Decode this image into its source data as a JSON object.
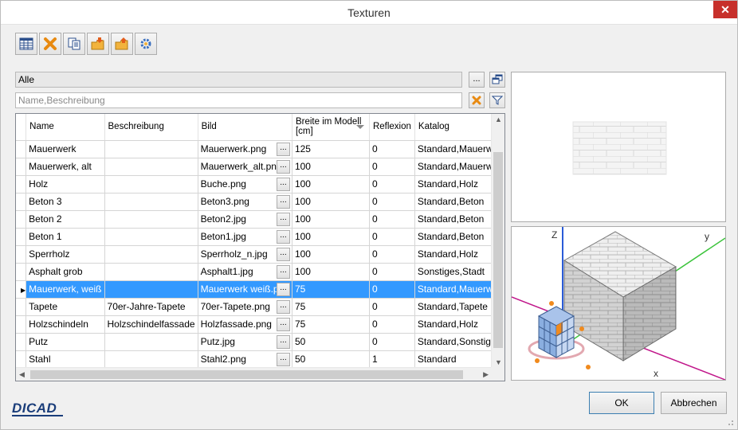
{
  "window": {
    "title": "Texturen"
  },
  "toolbar": {
    "buttons": [
      "table-icon",
      "delete-icon",
      "copy-icon",
      "import-icon",
      "export-icon",
      "settings-icon"
    ]
  },
  "filters": {
    "category_value": "Alle",
    "category_browse_label": "...",
    "search_placeholder": "Name,Beschreibung"
  },
  "table": {
    "columns": [
      "Name",
      "Beschreibung",
      "Bild",
      "Breite im Modell [cm]",
      "Reflexion",
      "Katalog"
    ],
    "ellipsis_label": "...",
    "rows": [
      {
        "name": "Mauerwerk",
        "beschreibung": "",
        "bild": "Mauerwerk.png",
        "breite": "125",
        "reflexion": "0",
        "katalog": "Standard,Mauerwerk",
        "selected": false
      },
      {
        "name": "Mauerwerk, alt",
        "beschreibung": "",
        "bild": "Mauerwerk_alt.png",
        "breite": "100",
        "reflexion": "0",
        "katalog": "Standard,Mauerwerk",
        "selected": false
      },
      {
        "name": "Holz",
        "beschreibung": "",
        "bild": "Buche.png",
        "breite": "100",
        "reflexion": "0",
        "katalog": "Standard,Holz",
        "selected": false
      },
      {
        "name": "Beton 3",
        "beschreibung": "",
        "bild": "Beton3.png",
        "breite": "100",
        "reflexion": "0",
        "katalog": "Standard,Beton",
        "selected": false
      },
      {
        "name": "Beton 2",
        "beschreibung": "",
        "bild": "Beton2.jpg",
        "breite": "100",
        "reflexion": "0",
        "katalog": "Standard,Beton",
        "selected": false
      },
      {
        "name": "Beton 1",
        "beschreibung": "",
        "bild": "Beton1.jpg",
        "breite": "100",
        "reflexion": "0",
        "katalog": "Standard,Beton",
        "selected": false
      },
      {
        "name": "Sperrholz",
        "beschreibung": "",
        "bild": "Sperrholz_n.jpg",
        "breite": "100",
        "reflexion": "0",
        "katalog": "Standard,Holz",
        "selected": false
      },
      {
        "name": "Asphalt grob",
        "beschreibung": "",
        "bild": "Asphalt1.jpg",
        "breite": "100",
        "reflexion": "0",
        "katalog": "Sonstiges,Stadt",
        "selected": false
      },
      {
        "name": "Mauerwerk, weiß",
        "beschreibung": "",
        "bild": "Mauerwerk weiß.png",
        "breite": "75",
        "reflexion": "0",
        "katalog": "Standard,Mauerwerk",
        "selected": true
      },
      {
        "name": "Tapete",
        "beschreibung": "70er-Jahre-Tapete",
        "bild": "70er-Tapete.png",
        "breite": "75",
        "reflexion": "0",
        "katalog": "Standard,Tapete",
        "selected": false
      },
      {
        "name": "Holzschindeln",
        "beschreibung": "Holzschindelfassade",
        "bild": "Holzfassade.png",
        "breite": "75",
        "reflexion": "0",
        "katalog": "Standard,Holz",
        "selected": false
      },
      {
        "name": "Putz",
        "beschreibung": "",
        "bild": "Putz.jpg",
        "breite": "50",
        "reflexion": "0",
        "katalog": "Standard,Sonstiges",
        "selected": false
      },
      {
        "name": "Stahl",
        "beschreibung": "",
        "bild": "Stahl2.png",
        "breite": "50",
        "reflexion": "1",
        "katalog": "Standard",
        "selected": false
      }
    ]
  },
  "preview3d": {
    "axis_z": "Z",
    "axis_y": "y",
    "axis_x": "x"
  },
  "footer": {
    "logo_text": "DICAD",
    "ok_label": "OK",
    "cancel_label": "Abbrechen"
  },
  "colors": {
    "selection": "#3399ff",
    "axis_z": "#2a5bd7",
    "axis_y": "#3cc43c",
    "axis_x": "#c0168a",
    "logo": "#1a3d7a"
  }
}
